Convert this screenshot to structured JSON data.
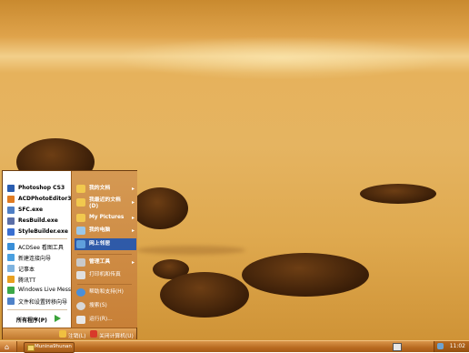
{
  "start_menu": {
    "left_items": [
      {
        "label": "Photoshop CS3",
        "bold": true,
        "color": "#2a5db0"
      },
      {
        "label": "ACDPhotoEditor3....",
        "bold": true,
        "color": "#e07b22"
      },
      {
        "label": "SFC.exe",
        "bold": true,
        "color": "#4f7fc5"
      },
      {
        "label": "ResBuild.exe",
        "bold": true,
        "color": "#5b6fa8"
      },
      {
        "label": "StyleBuilder.exe",
        "bold": true,
        "color": "#3b6fd0"
      },
      {
        "label": "ACDSee 看图工具",
        "bold": false,
        "color": "#3a8fd8"
      },
      {
        "label": "新建连接向导",
        "bold": false,
        "color": "#4aa0e0"
      },
      {
        "label": "记事本",
        "bold": false,
        "color": "#7fb3df"
      },
      {
        "label": "腾讯TT",
        "bold": false,
        "color": "#e8a020"
      },
      {
        "label": "Windows Live Messe...",
        "bold": false,
        "color": "#3ca848"
      },
      {
        "label": "文件和设置转移向导",
        "bold": false,
        "color": "#4f82c8"
      }
    ],
    "all_programs": "所有程序(P)",
    "right_items": [
      {
        "label": "我的文档",
        "chevron": "▸",
        "icon": "folder-icon",
        "color": "#f1c84e"
      },
      {
        "label": "我最近的文档",
        "label2": "(D)",
        "chevron": "▸",
        "icon": "recent-docs-icon",
        "color": "#f1c84e"
      },
      {
        "label": "My Pictures",
        "chevron": "▸",
        "icon": "pictures-icon",
        "color": "#f1c84e"
      },
      {
        "label": "我的电脑",
        "chevron": "▸",
        "icon": "computer-icon",
        "color": "#9bc7e8"
      },
      {
        "label": "网上邻居",
        "chevron": "",
        "icon": "network-icon",
        "color": "#5f9fdc"
      },
      {
        "label": "管理工具",
        "chevron": "▸",
        "icon": "admin-tools-icon",
        "color": "#c9c9c9"
      },
      {
        "label": "打印机和传真",
        "chevron": "",
        "icon": "printer-icon",
        "color": "#e0e0e0"
      },
      {
        "label": "帮助和支持(H)",
        "chevron": "",
        "icon": "help-icon",
        "color": "#4a8fd8"
      },
      {
        "label": "搜索(S)",
        "chevron": "",
        "icon": "search-icon",
        "color": "#d8d8d8"
      },
      {
        "label": "运行(R)...",
        "chevron": "",
        "icon": "run-icon",
        "color": "#e8e8e8"
      }
    ],
    "logoff": "注销(L)",
    "shutdown": "关闭计算机(U)"
  },
  "taskbar": {
    "task_label": "Munina9hunan",
    "clock": "11:02"
  },
  "colors": {
    "highlight": "#2f5aa8",
    "menu_orange": "#c88037"
  }
}
